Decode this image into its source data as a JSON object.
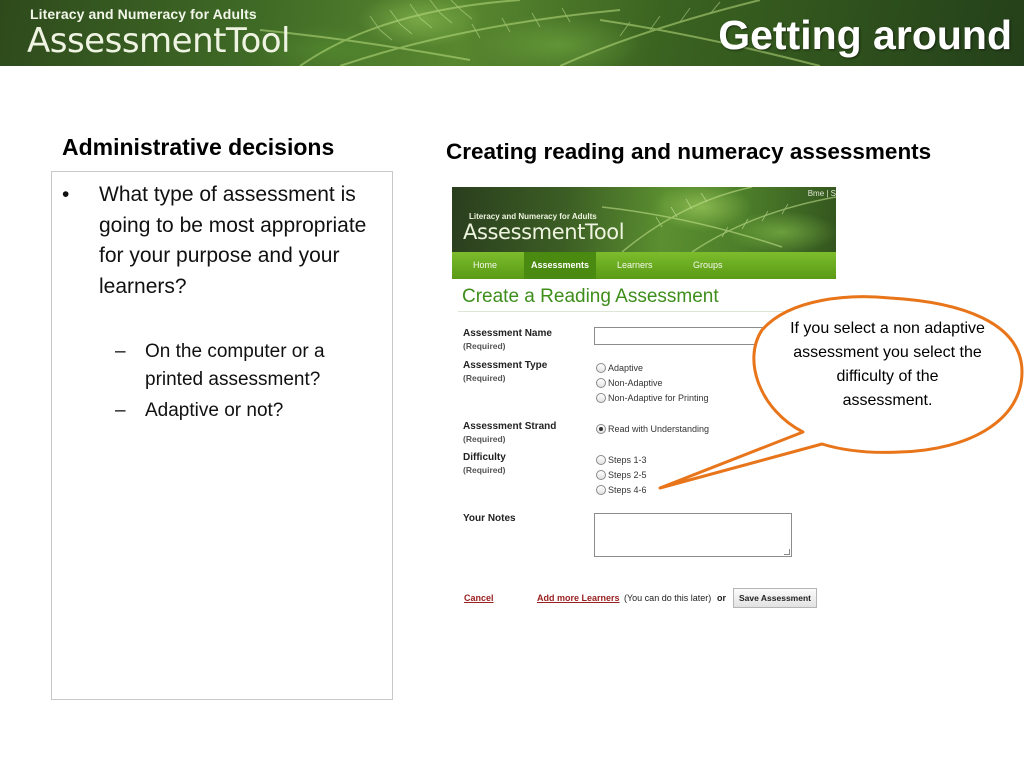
{
  "header": {
    "caption": "Literacy and Numeracy for Adults",
    "app_title": "AssessmentTool",
    "slide_title": "Getting around"
  },
  "left": {
    "heading": "Administrative decisions",
    "bullet": "What type of assessment is going to be most appropriate for your purpose and your learners?",
    "bullet_marker": "•",
    "sub_marker": "–",
    "sub_items": [
      "On the computer or a printed assessment?",
      "Adaptive or not?"
    ]
  },
  "right": {
    "heading": "Creating reading and numeracy assessments"
  },
  "screenshot": {
    "caption": "Literacy and Numeracy for Adults",
    "app_title": "AssessmentTool",
    "corner_text": "Bme | S",
    "nav": [
      "Home",
      "Assessments",
      "Learners",
      "Groups"
    ],
    "form_title": "Create a Reading Assessment",
    "fields": {
      "name_label": "Assessment Name",
      "type_label": "Assessment Type",
      "strand_label": "Assessment Strand",
      "difficulty_label": "Difficulty",
      "notes_label": "Your Notes",
      "required": "(Required)"
    },
    "type_options": [
      "Adaptive",
      "Non-Adaptive",
      "Non-Adaptive for Printing"
    ],
    "strand_option": "Read with Understanding",
    "difficulty_options": [
      "Steps 1-3",
      "Steps 2-5",
      "Steps 4-6"
    ],
    "cancel": "Cancel",
    "add_learners": "Add more Learners",
    "later_note": "(You can do this later)",
    "or": "or",
    "save": "Save Assessment"
  },
  "callout": {
    "text": "If you select a non adaptive assessment you select the difficulty of the assessment."
  },
  "colors": {
    "callout_border": "#e8751a",
    "nav_green": "#6aab22",
    "form_title": "#3e8e1c",
    "link_red": "#9a2020"
  }
}
